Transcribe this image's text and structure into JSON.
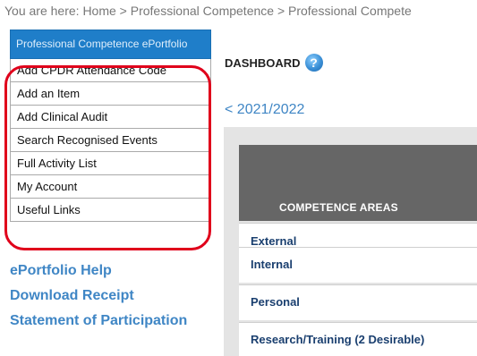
{
  "breadcrumb": {
    "text": "You are here: Home > Professional Competence > Professional Compete"
  },
  "sidebar": {
    "header": "Professional Competence ePortfolio",
    "items": [
      {
        "label": "Add CPDR Attendance Code"
      },
      {
        "label": "Add an Item"
      },
      {
        "label": "Add Clinical Audit"
      },
      {
        "label": "Search Recognised Events"
      },
      {
        "label": "Full Activity List"
      },
      {
        "label": "My Account"
      },
      {
        "label": "Useful Links"
      }
    ]
  },
  "links": {
    "help": "ePortfolio Help",
    "receipt": "Download Receipt",
    "statement": "Statement of Participation"
  },
  "dashboard": {
    "title": "DASHBOARD",
    "help_icon_glyph": "?",
    "year_nav": "< 2021/2022"
  },
  "table": {
    "header": "COMPETENCE AREAS",
    "rows": [
      {
        "label": "External"
      },
      {
        "label": "Internal"
      },
      {
        "label": "Personal"
      },
      {
        "label": "Research/Training (2 Desirable)"
      }
    ]
  },
  "colors": {
    "sidebar_header_bg": "#1f7ec9",
    "link": "#3f86c5",
    "highlight": "#e0001b",
    "table_header_bg": "#666666"
  }
}
